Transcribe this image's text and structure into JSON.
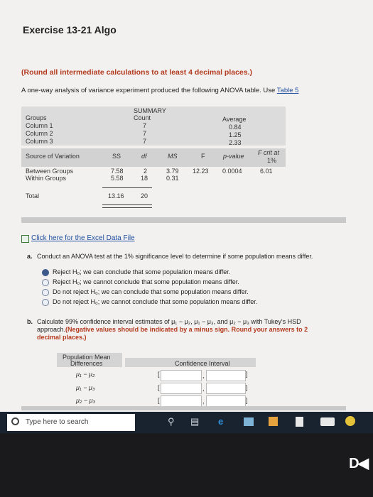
{
  "title": "Exercise 13-21 Algo",
  "hint": "(Round all intermediate calculations to at least 4 decimal places.)",
  "intro_text": "A one-way analysis of variance experiment produced the following ANOVA table. Use",
  "intro_link": "Table 5",
  "summary": {
    "header": "SUMMARY",
    "col_groups": "Groups",
    "col_count": "Count",
    "col_average": "Average",
    "rows": [
      {
        "group": "Column 1",
        "count": "7",
        "average": "0.84"
      },
      {
        "group": "Column 2",
        "count": "7",
        "average": "1.25"
      },
      {
        "group": "Column 3",
        "count": "7",
        "average": "2.33"
      }
    ]
  },
  "anova": {
    "h_source": "Source of Variation",
    "h_ss": "SS",
    "h_df": "df",
    "h_ms": "MS",
    "h_f": "F",
    "h_p": "p-value",
    "h_fcrit": "F crit at",
    "h_fcrit2": "1%",
    "rows": [
      {
        "source": "Between Groups",
        "ss": "7.58",
        "df": "2",
        "ms": "3.79",
        "f": "12.23",
        "p": "0.0004",
        "fcrit": "6.01"
      },
      {
        "source": "Within Groups",
        "ss": "5.58",
        "df": "18",
        "ms": "0.31",
        "f": "",
        "p": "",
        "fcrit": ""
      }
    ],
    "total_label": "Total",
    "total_ss": "13.16",
    "total_df": "20"
  },
  "excel_link": "Click here for the Excel Data File",
  "part_a": {
    "label": "a.",
    "question": "Conduct an ANOVA test at the 1% significance level to determine if some population means differ.",
    "options": [
      "Reject H₀; we can conclude that some population means differ.",
      "Reject H₀; we cannot conclude that some population means differ.",
      "Do not reject H₀; we can conclude that some population means differ.",
      "Do not reject H₀; we cannot conclude that some population means differ."
    ],
    "selected": 0
  },
  "part_b": {
    "label": "b.",
    "line1": "Calculate 99% confidence interval estimates of μ₁ − μ₂, μ₁ − μ₃, and μ₂ − μ₃ with Tukey's HSD",
    "line2_plain": "approach.",
    "line2_red": "(Negative values should be indicated by a minus sign. Round your answers to 2",
    "line3_red": "decimal places.)"
  },
  "ci_table": {
    "h_diff1": "Population Mean",
    "h_diff2": "Differences",
    "h_ci": "Confidence Interval",
    "rows": [
      {
        "label": "μ₁ − μ₂",
        "open": "[",
        "sep": ",",
        "close": "]"
      },
      {
        "label": "μ₁ − μ₃",
        "open": "[",
        "sep": ",",
        "close": "]"
      },
      {
        "label": "μ₂ − μ₃",
        "open": "[",
        "sep": ",",
        "close": "]"
      }
    ]
  },
  "taskbar": {
    "search_placeholder": "Type here to search"
  },
  "brand_mark": "D◀"
}
